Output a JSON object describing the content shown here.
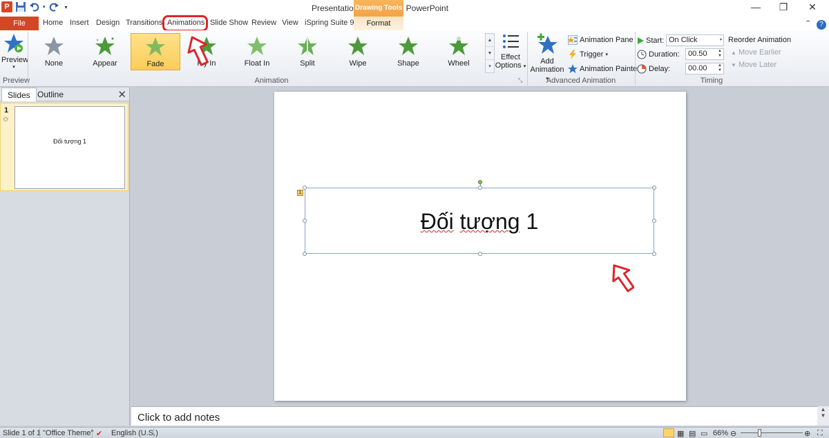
{
  "window": {
    "app_icon": "P",
    "title": "Presentation1 - Microsoft PowerPoint",
    "contextual_group": "Drawing Tools",
    "minimize": "—",
    "restore": "❐",
    "close": "✕"
  },
  "tabs": {
    "file": "File",
    "items": [
      "Home",
      "Insert",
      "Design",
      "Transitions",
      "Animations",
      "Slide Show",
      "Review",
      "View",
      "iSpring Suite 9"
    ],
    "format": "Format"
  },
  "ribbon": {
    "preview": {
      "label": "Preview",
      "group": "Preview"
    },
    "animation_group": "Animation",
    "effects": [
      {
        "label": "None",
        "color": "#8d96a3"
      },
      {
        "label": "Appear",
        "color": "#4d9a3a"
      },
      {
        "label": "Fade",
        "color": "#6cb55a"
      },
      {
        "label": "Fly In",
        "color": "#4d9a3a"
      },
      {
        "label": "Float In",
        "color": "#7fbf6b"
      },
      {
        "label": "Split",
        "color": "#6aae57"
      },
      {
        "label": "Wipe",
        "color": "#4d9a3a"
      },
      {
        "label": "Shape",
        "color": "#4d9a3a"
      },
      {
        "label": "Wheel",
        "color": "#4d9a3a"
      }
    ],
    "selected_effect": "Fade",
    "effect_options": {
      "line1": "Effect",
      "line2": "Options"
    },
    "advanced": {
      "group": "Advanced Animation",
      "add_line1": "Add",
      "add_line2": "Animation",
      "animation_pane": "Animation Pane",
      "trigger": "Trigger",
      "animation_painter": "Animation Painter"
    },
    "timing": {
      "group": "Timing",
      "start_label": "Start:",
      "start_value": "On Click",
      "duration_label": "Duration:",
      "duration_value": "00.50",
      "delay_label": "Delay:",
      "delay_value": "00.00",
      "reorder": "Reorder Animation",
      "move_earlier": "Move Earlier",
      "move_later": "Move Later"
    }
  },
  "left_panel": {
    "tab_slides": "Slides",
    "tab_outline": "Outline",
    "slide_number": "1",
    "thumb_text": "Đối tượng 1"
  },
  "slide": {
    "text": "Đối tượng 1",
    "text_part1": "Đối",
    "text_part2": "tượng",
    "text_part3": "1",
    "badge": "1"
  },
  "notes": {
    "placeholder": "Click to add notes"
  },
  "status": {
    "slide_info": "Slide 1 of 1",
    "theme": "\"Office Theme\"",
    "language": "English (U.S.)",
    "zoom": "66%"
  },
  "colors": {
    "brand": "#d24726",
    "highlight_red": "#d9262b",
    "selected_effect_bg": "#fbcc5a"
  }
}
